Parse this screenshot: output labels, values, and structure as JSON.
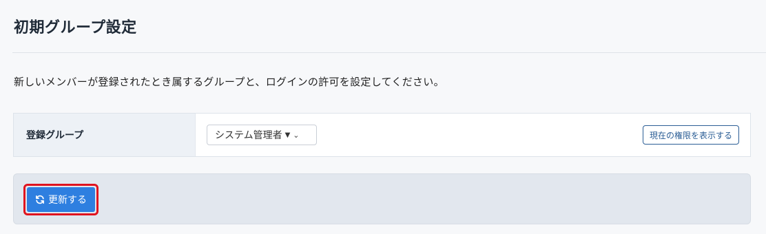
{
  "header": {
    "title": "初期グループ設定"
  },
  "description": "新しいメンバーが登録されたとき属するグループと、ログインの許可を設定してください。",
  "setting": {
    "label": "登録グループ",
    "select_value": "システム管理者",
    "show_permissions_label": "現在の権限を表示する"
  },
  "actions": {
    "update_label": "更新する"
  },
  "icons": {
    "caret": "caret-down-icon",
    "chevron": "chevron-down-icon",
    "refresh": "refresh-icon"
  },
  "colors": {
    "primary": "#2e7fe0",
    "highlight": "#e0141f",
    "link": "#2a5d95"
  }
}
